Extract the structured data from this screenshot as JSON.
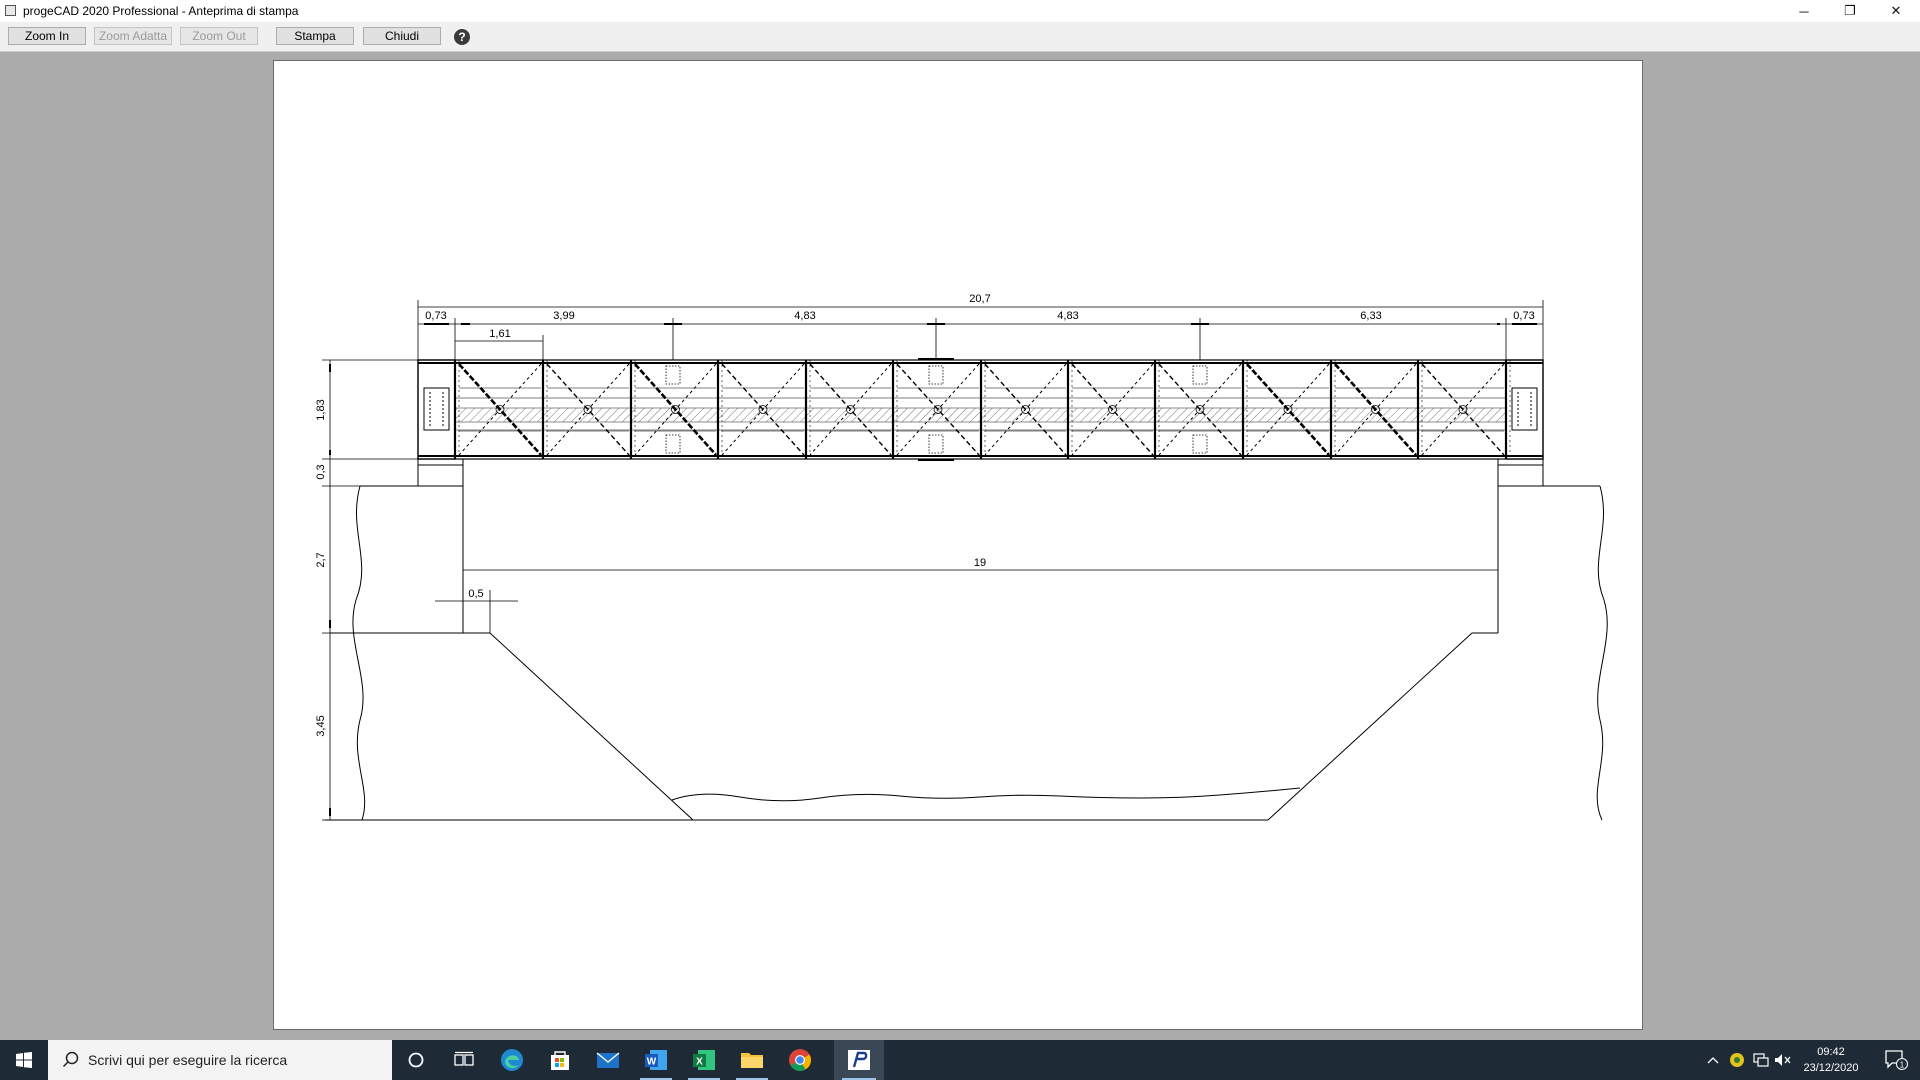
{
  "window": {
    "title": "progeCAD 2020 Professional - Anteprima di stampa",
    "minimize_glyph": "─",
    "restore_glyph": "❐",
    "close_glyph": "✕"
  },
  "toolbar": {
    "zoom_in": "Zoom In",
    "zoom_fit": "Zoom Adatta",
    "zoom_out": "Zoom Out",
    "print": "Stampa",
    "close": "Chiudi",
    "help_glyph": "?"
  },
  "drawing": {
    "dim_total": "20,7",
    "dim_top": [
      "0,73",
      "3,99",
      "4,83",
      "4,83",
      "6,33",
      "0,73"
    ],
    "dim_sub": "1,61",
    "dim_span": "19",
    "dim_seat": "0,5",
    "dim_vertical": [
      "1,83",
      "0,3",
      "2,7",
      "3,45"
    ]
  },
  "taskbar": {
    "search_placeholder": "Scrivi qui per eseguire la ricerca",
    "time": "09:42",
    "date": "23/12/2020",
    "notification_count": "1",
    "apps": [
      "cortana-icon",
      "task-view-icon",
      "edge-icon",
      "store-icon",
      "mail-icon",
      "word-icon",
      "excel-icon",
      "file-explorer-icon",
      "chrome-icon",
      "progecad-icon"
    ]
  }
}
